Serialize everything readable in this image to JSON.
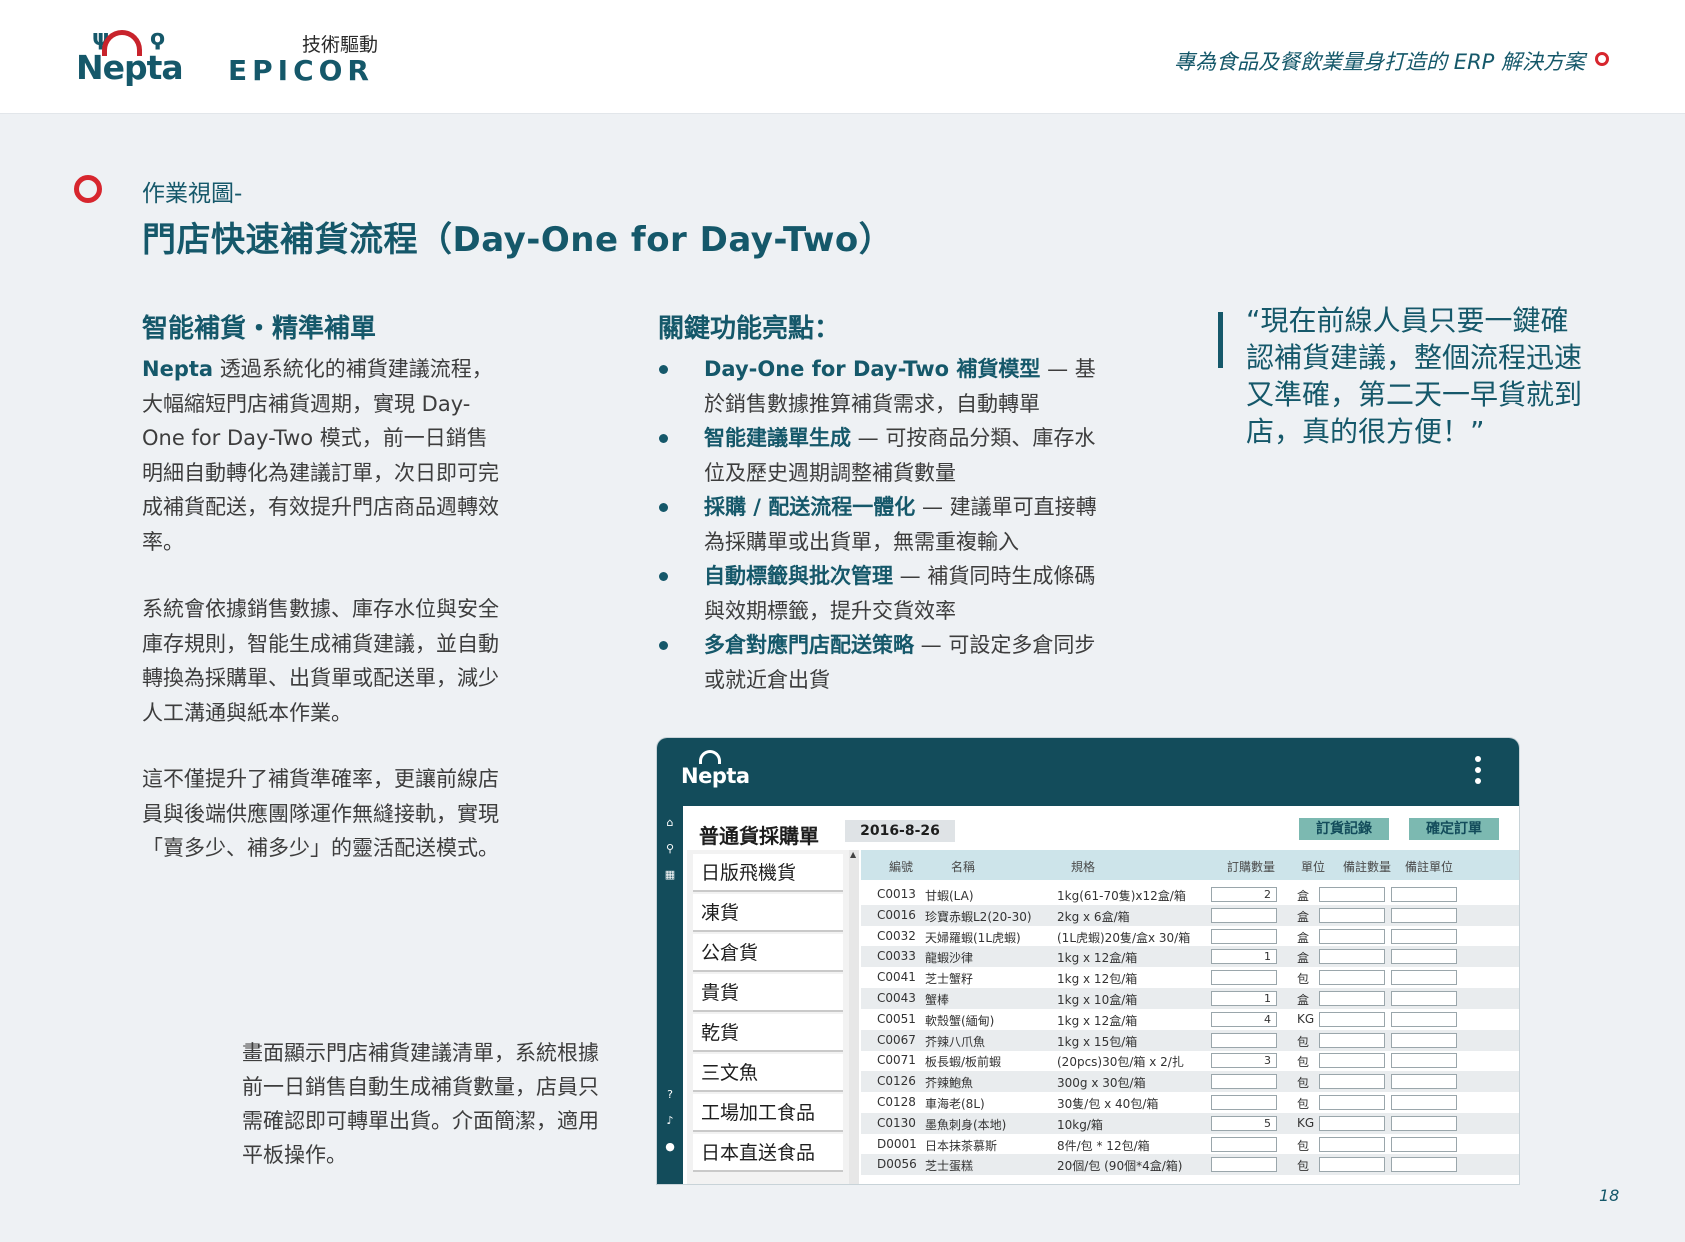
{
  "header": {
    "brand_primary": "Nepta",
    "brand_secondary_tag": "技術驅動",
    "brand_secondary": "EPICOR",
    "tagline": "專為食品及餐飲業量身打造的 ERP 解決方案"
  },
  "title": {
    "eyebrow": "作業視圖-",
    "main": "門店快速補貨流程（Day-One for Day-Two）"
  },
  "left": {
    "heading": "智能補貨・精準補單",
    "p1_lead": "Nepta",
    "p1_rest": " 透過系統化的補貨建議流程，大幅縮短門店補貨週期，實現 Day-One for Day-Two 模式，前一日銷售明細自動轉化為建議訂單，次日即可完成補貨配送，有效提升門店商品週轉效率。",
    "p2": "系統會依據銷售數據、庫存水位與安全庫存規則，智能生成補貨建議，並自動轉換為採購單、出貨單或配送單，減少人工溝通與紙本作業。",
    "p3": "這不僅提升了補貨準確率，更讓前線店員與後端供應團隊運作無縫接軌，實現「賣多少、補多少」的靈活配送模式。"
  },
  "middle": {
    "heading": "關鍵功能亮點：",
    "bullets": [
      {
        "lead": "Day-One for Day-Two 補貨模型",
        "rest": " — 基於銷售數據推算補貨需求，自動轉單"
      },
      {
        "lead": "智能建議單生成",
        "rest": " — 可按商品分類、庫存水位及歷史週期調整補貨數量"
      },
      {
        "lead": "採購 / 配送流程一體化",
        "rest": " — 建議單可直接轉為採購單或出貨單，無需重複輸入"
      },
      {
        "lead": "自動標籤與批次管理",
        "rest": " — 補貨同時生成條碼與效期標籤，提升交貨效率"
      },
      {
        "lead": "多倉對應門店配送策略",
        "rest": " — 可設定多倉同步或就近倉出貨"
      }
    ]
  },
  "quote": "“現在前線人員只要一鍵確認補貨建議，整個流程迅速又準確，第二天一早貨就到店，真的很方便！”",
  "caption": "畫面顯示門店補貨建議清單，系統根據前一日銷售自動生成補貨數量，店員只需確認即可轉單出貨。介面簡潔，適用平板操作。",
  "page_number": "18",
  "colors": {
    "brand": "#15586a",
    "accent": "#d7262e",
    "app_bar": "#134c5b",
    "button": "#7cb9b1"
  },
  "app": {
    "logo": "Nepta",
    "rail_icons": [
      "home-icon",
      "search-icon",
      "grid-icon",
      "help-icon",
      "bell-icon",
      "user-icon"
    ],
    "form_title": "普通貨採購單",
    "date": "2016-8-26",
    "buttons": {
      "history": "訂貨記錄",
      "confirm": "確定訂單"
    },
    "categories": [
      "日版飛機貨",
      "凍貨",
      "公倉貨",
      "貴貨",
      "乾貨",
      "三文魚",
      "工場加工食品",
      "日本直送食品"
    ],
    "columns": [
      "編號",
      "名稱",
      "規格",
      "訂購數量",
      "單位",
      "備註數量",
      "備註單位"
    ],
    "rows": [
      {
        "code": "C0013",
        "name": "甘蝦(LA)",
        "spec": "1kg(61-70隻)x12盒/箱",
        "qty": "2",
        "unit": "盒"
      },
      {
        "code": "C0016",
        "name": "珍寶赤蝦L2(20-30)",
        "spec": "2kg x 6盒/箱",
        "qty": "",
        "unit": "盒"
      },
      {
        "code": "C0032",
        "name": "天婦羅蝦(1L虎蝦)",
        "spec": "(1L虎蝦)20隻/盒x 30/箱",
        "qty": "",
        "unit": "盒"
      },
      {
        "code": "C0033",
        "name": "龍蝦沙律",
        "spec": "1kg x 12盒/箱",
        "qty": "1",
        "unit": "盒"
      },
      {
        "code": "C0041",
        "name": "芝士蟹籽",
        "spec": "1kg x 12包/箱",
        "qty": "",
        "unit": "包"
      },
      {
        "code": "C0043",
        "name": "蟹棒",
        "spec": "1kg x 10盒/箱",
        "qty": "1",
        "unit": "盒"
      },
      {
        "code": "C0051",
        "name": "軟殼蟹(緬甸)",
        "spec": "1kg x 12盒/箱",
        "qty": "4",
        "unit": "KG"
      },
      {
        "code": "C0067",
        "name": "芥辣八爪魚",
        "spec": "1kg x 15包/箱",
        "qty": "",
        "unit": "包"
      },
      {
        "code": "C0071",
        "name": "板長蝦/板前蝦",
        "spec": "(20pcs)30包/箱 x 2/扎",
        "qty": "3",
        "unit": "包"
      },
      {
        "code": "C0126",
        "name": "芥辣鮑魚",
        "spec": "300g x 30包/箱",
        "qty": "",
        "unit": "包"
      },
      {
        "code": "C0128",
        "name": "車海老(8L)",
        "spec": "30隻/包 x 40包/箱",
        "qty": "",
        "unit": "包"
      },
      {
        "code": "C0130",
        "name": "墨魚刺身(本地)",
        "spec": "10kg/箱",
        "qty": "5",
        "unit": "KG"
      },
      {
        "code": "D0001",
        "name": "日本抹茶慕斯",
        "spec": "8件/包 * 12包/箱",
        "qty": "",
        "unit": "包"
      },
      {
        "code": "D0056",
        "name": "芝士蛋糕",
        "spec": "20個/包 (90個*4盒/箱)",
        "qty": "",
        "unit": "包"
      }
    ]
  }
}
